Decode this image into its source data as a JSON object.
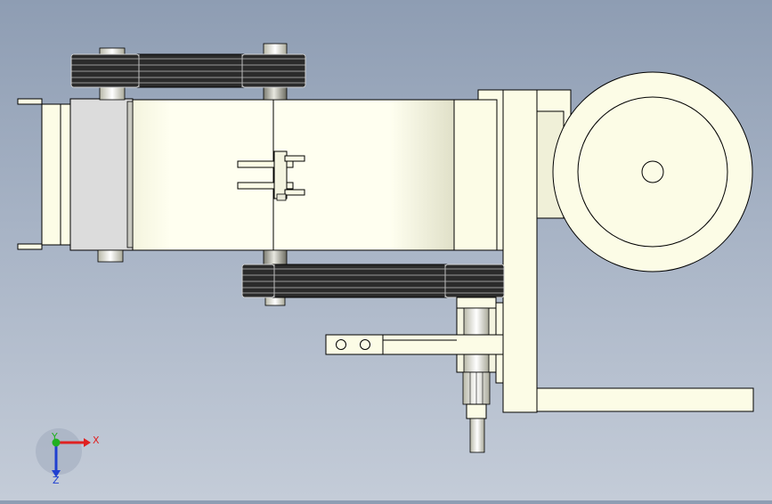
{
  "viewport": {
    "background_top": "#8e9db3",
    "background_bottom": "#c4ccd8"
  },
  "triad": {
    "x_label": "X",
    "y_label": "Y",
    "z_label": "Z",
    "x_color": "#e02020",
    "y_color": "#20b020",
    "z_color": "#2040d0"
  },
  "colors": {
    "part_fill": "#fcfce6",
    "part_stroke": "#000000",
    "belt_dark": "#2b2b2b",
    "belt_light": "#9a9a9a",
    "housing_grey": "#dcdcdc"
  }
}
